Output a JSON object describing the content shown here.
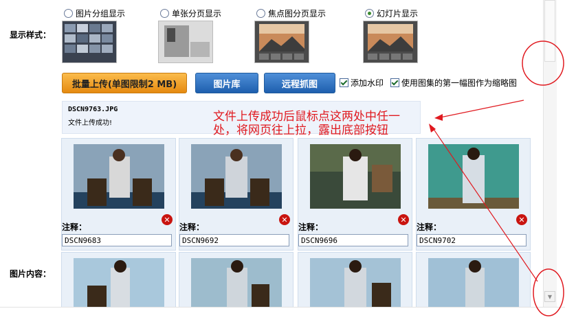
{
  "display_style": {
    "label": "显示样式：",
    "options": [
      {
        "label": "图片分组显示",
        "selected": false
      },
      {
        "label": "单张分页显示",
        "selected": false
      },
      {
        "label": "焦点图分页显示",
        "selected": false
      },
      {
        "label": "幻灯片显示",
        "selected": true
      }
    ]
  },
  "toolbar": {
    "batch_upload_label": "批量上传(单图限制2 MB)",
    "gallery_label": "图片库",
    "remote_fetch_label": "远程抓图",
    "watermark_label": "添加水印",
    "watermark_checked": true,
    "use_first_as_thumb_label": "使用图集的第一幅图作为缩略图",
    "use_first_as_thumb_checked": true
  },
  "upload_status": {
    "filename": "DSCN9763.JPG",
    "message": "文件上传成功!"
  },
  "annotation": {
    "text": "文件上传成功后鼠标点这两处中任一处，将网页往上拉，露出底部按钮"
  },
  "image_content": {
    "label": "图片内容：",
    "note_label": "注释：",
    "items": [
      {
        "caption": "DSCN9683"
      },
      {
        "caption": "DSCN9692"
      },
      {
        "caption": "DSCN9696"
      },
      {
        "caption": "DSCN9702"
      }
    ]
  },
  "colors": {
    "accent_orange": "#f0a020",
    "accent_blue": "#2a6ab8",
    "annotation_red": "#e0191f",
    "delete_red": "#c9140f"
  }
}
